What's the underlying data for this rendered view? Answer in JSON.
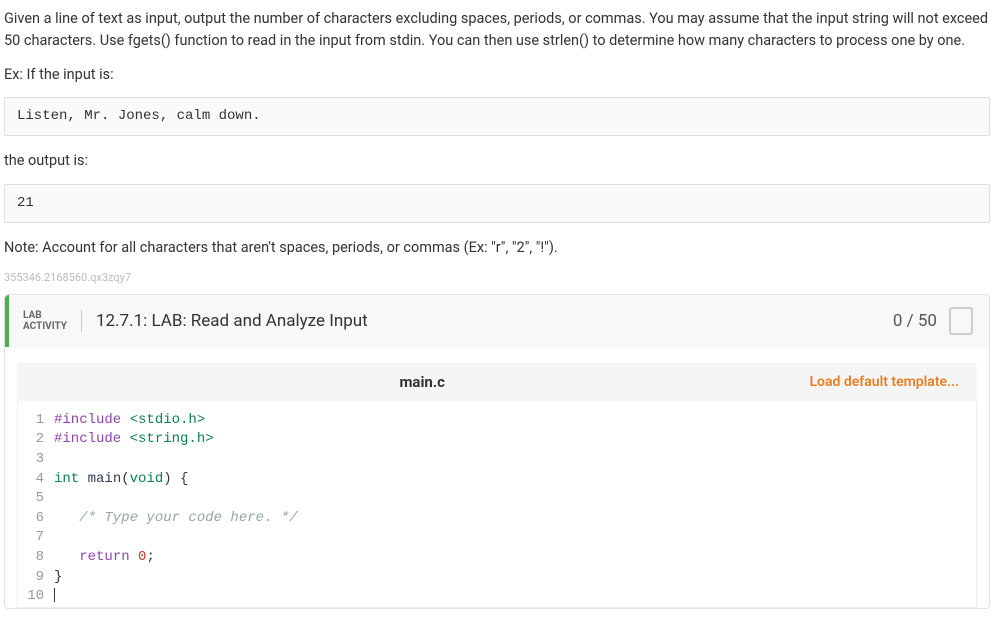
{
  "instructions": {
    "p1": "Given a line of text as input, output the number of characters excluding spaces, periods, or commas. You may assume that the input string will not exceed 50 characters. Use fgets() function to read in the input from stdin. You can then use strlen() to determine how many characters to process one by one.",
    "p2": "Ex: If the input is:",
    "example_input": "Listen, Mr. Jones, calm down.",
    "p3": "the output is:",
    "example_output": "21",
    "p4": "Note: Account for all characters that aren't spaces, periods, or commas (Ex: \"r\", \"2\", \"!\").",
    "small_id": "355346.2168560.qx3zqy7"
  },
  "lab": {
    "badge_line1": "LAB",
    "badge_line2": "ACTIVITY",
    "title": "12.7.1: LAB: Read and Analyze Input",
    "score": "0 / 50"
  },
  "editor": {
    "filename": "main.c",
    "load_template": "Load default template...",
    "lines": {
      "l1a": "#include",
      "l1b": " <stdio.h>",
      "l2a": "#include",
      "l2b": " <string.h>",
      "l3": "",
      "l4a": "int",
      "l4b": " main",
      "l4c": "(",
      "l4d": "void",
      "l4e": ") {",
      "l5": "",
      "l6": "   /* Type your code here. */",
      "l7": "",
      "l8a": "   ",
      "l8b": "return",
      "l8c": " ",
      "l8d": "0",
      "l8e": ";",
      "l9": "}",
      "l10": ""
    },
    "linenums": {
      "n1": "1",
      "n2": "2",
      "n3": "3",
      "n4": "4",
      "n5": "5",
      "n6": "6",
      "n7": "7",
      "n8": "8",
      "n9": "9",
      "n10": "10"
    }
  }
}
